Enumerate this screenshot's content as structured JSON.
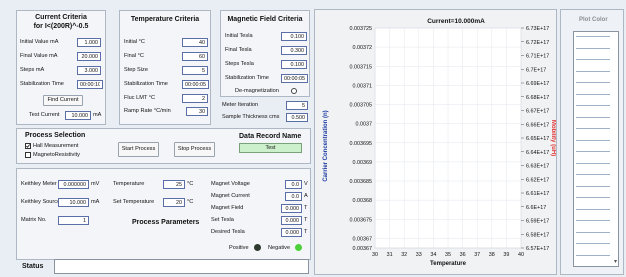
{
  "current_criteria": {
    "title": "Current Criteria",
    "subtitle": "for I<(200R)^-0.5",
    "initial_value_label": "Initial Value mA",
    "initial_value": "1.000",
    "final_value_label": "Final Value mA",
    "final_value": "20.000",
    "steps_label": "Steps mA",
    "steps": "3.000",
    "stabilization_label": "Stabilization Time",
    "stabilization": "00:00:10",
    "find_current_label": "Find Current",
    "test_current_label": "Test Current",
    "test_current": "10.000",
    "test_current_unit": "mA"
  },
  "temperature_criteria": {
    "title": "Temperature Criteria",
    "initial_label": "Initial °C",
    "initial": "40",
    "final_label": "Final °C",
    "final": "60",
    "step_label": "Step Size",
    "step": "5",
    "stabilization_label": "Stabilization Time",
    "stabilization": "00:00:05",
    "fluc_label": "Fluc LMT °C",
    "fluc": "2",
    "ramp_label": "Ramp Rate °C/min",
    "ramp": "30"
  },
  "magnetic_criteria": {
    "title": "Magnetic Field Criteria",
    "initial_label": "Initial Tesla",
    "initial": "0.100",
    "final_label": "Final Tesla",
    "final": "0.300",
    "steps_label": "Steps Tesla",
    "steps": "0.100",
    "stabilization_label": "Stabilization Time",
    "stabilization": "00:00:05",
    "demag_label": "De-magnetization",
    "meter_iteration_label": "Meter Iteration",
    "meter_iteration": "5",
    "sample_thickness_label": "Sample Thickness cms",
    "sample_thickness": "0.500"
  },
  "process_selection": {
    "title": "Process Selection",
    "hall_label": "Hall Measurement",
    "hall_checked": true,
    "magneto_label": "MagnetoResistivity",
    "magneto_checked": false,
    "start_label": "Start Process",
    "stop_label": "Stop Process",
    "data_record_title": "Data Record Name",
    "data_record_value": "Test"
  },
  "process_parameters": {
    "title": "Process Parameters",
    "keithley_meter_label": "Keithley Meter",
    "keithley_meter": "0.000000",
    "keithley_meter_unit": "mV",
    "keithley_source_label": "Keithley Source",
    "keithley_source": "10.000",
    "keithley_source_unit": "mA",
    "matrix_label": "Matrix No.",
    "matrix": "1",
    "temperature_label": "Temperature",
    "temperature": "25",
    "temperature_unit": "°C",
    "set_temperature_label": "Set Temperature",
    "set_temperature": "20",
    "set_temperature_unit": "°C",
    "magnet_voltage_label": "Magnet Voltage",
    "magnet_voltage": "0.0",
    "magnet_voltage_unit": "V",
    "magnet_current_label": "Magnet Current",
    "magnet_current": "0.0",
    "magnet_current_unit": "A",
    "magnet_field_label": "Magnet Field",
    "magnet_field": "0.000",
    "magnet_field_unit": "T",
    "set_tesla_label": "Set Tesla",
    "set_tesla": "0.000",
    "set_tesla_unit": "T",
    "desired_tesla_label": "Desired Tesla",
    "desired_tesla": "0.000",
    "desired_tesla_unit": "T",
    "positive_label": "Positive",
    "negative_label": "Negative",
    "positive_color": "#2f3a2f",
    "negative_color": "#4cd13a"
  },
  "status": {
    "label": "Status",
    "value": ""
  },
  "plot_color": {
    "title": "Plot Color"
  },
  "chart_data": {
    "type": "scatter",
    "title": "Current=10.000mA",
    "xlabel": "Temperature",
    "ylabel": "Carrier Concentration (n)",
    "y2label": "Mobility (uH)",
    "xlim": [
      30,
      40
    ],
    "x_ticks": [
      "30",
      "31",
      "32",
      "33",
      "34",
      "35",
      "36",
      "37",
      "38",
      "39",
      "40"
    ],
    "ylim": [
      0.003667,
      0.003725
    ],
    "y_ticks": [
      "0.003725",
      "0.00372",
      "0.003715",
      "0.00371",
      "0.003705",
      "0.0037",
      "0.003695",
      "0.00369",
      "0.003685",
      "0.00368",
      "0.003675",
      "0.00367"
    ],
    "y2_ticks": [
      "6.73E+17",
      "6.72E+17",
      "6.71E+17",
      "6.7E+17",
      "6.69E+17",
      "6.68E+17",
      "6.67E+17",
      "6.66E+17",
      "6.65E+17",
      "6.64E+17",
      "6.63E+17",
      "6.62E+17",
      "6.61E+17",
      "6.6E+17",
      "6.59E+17",
      "6.58E+17",
      "6.57E+17"
    ],
    "y_bottom_label": "0.00367",
    "grid": true,
    "series": []
  }
}
